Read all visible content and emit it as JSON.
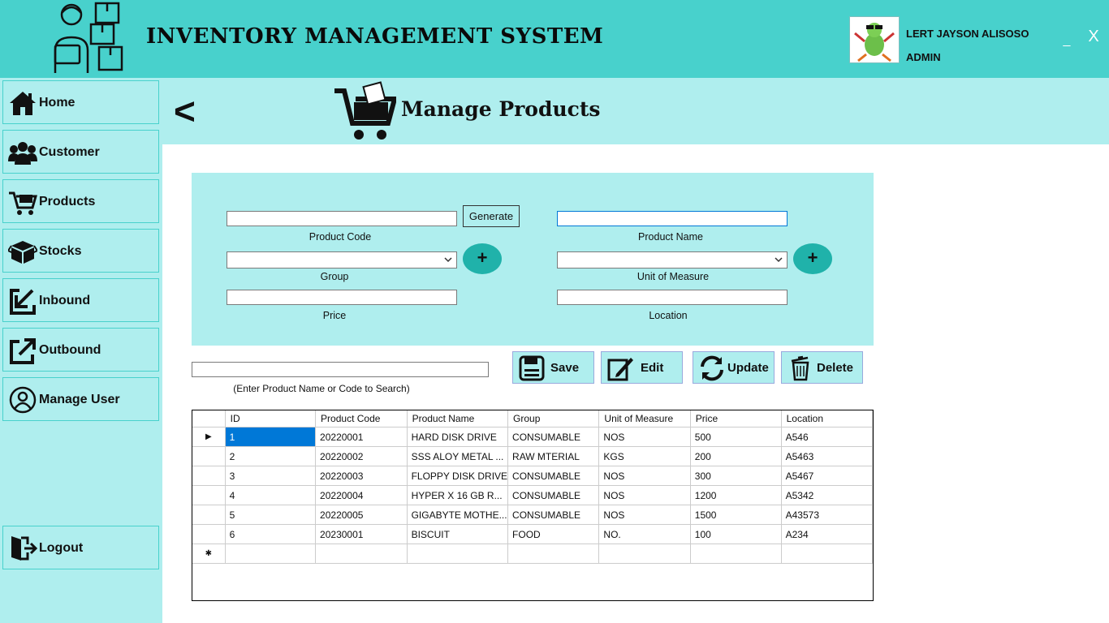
{
  "app": {
    "title": "INVENTORY MANAGEMENT SYSTEM",
    "user_name": "LERT JAYSON ALISOSO",
    "user_role": "ADMIN",
    "minimize": "_",
    "close": "X"
  },
  "sidebar": {
    "items": [
      {
        "label": "Home",
        "icon": "home-icon"
      },
      {
        "label": "Customer",
        "icon": "users-icon"
      },
      {
        "label": "Products",
        "icon": "cart-icon"
      },
      {
        "label": "Stocks",
        "icon": "boxes-icon"
      },
      {
        "label": "Inbound",
        "icon": "inbound-arrow-icon"
      },
      {
        "label": "Outbound",
        "icon": "outbound-arrow-icon"
      },
      {
        "label": "Manage User",
        "icon": "user-circle-icon"
      }
    ],
    "logout": "Logout"
  },
  "page": {
    "back": "<",
    "title": "Manage Products"
  },
  "form": {
    "product_code_label": "Product Code",
    "product_code_value": "",
    "generate": "Generate",
    "product_name_label": "Product Name",
    "product_name_value": "",
    "group_label": "Group",
    "uom_label": "Unit of Measure",
    "price_label": "Price",
    "location_label": "Location",
    "add_symbol": "+"
  },
  "search": {
    "value": "",
    "hint": "(Enter Product Name or Code to Search)"
  },
  "actions": {
    "save": "Save",
    "edit": "Edit",
    "update": "Update",
    "delete": "Delete"
  },
  "grid": {
    "columns": [
      "ID",
      "Product Code",
      "Product Name",
      "Group",
      "Unit of Measure",
      "Price",
      "Location"
    ],
    "rows": [
      [
        "1",
        "20220001",
        "HARD DISK DRIVE",
        "CONSUMABLE",
        "NOS",
        "500",
        "A546"
      ],
      [
        "2",
        "20220002",
        "SSS ALOY METAL ...",
        "RAW MTERIAL",
        "KGS",
        "200",
        "A5463"
      ],
      [
        "3",
        "20220003",
        "FLOPPY DISK DRIVE",
        "CONSUMABLE",
        "NOS",
        "300",
        "A5467"
      ],
      [
        "4",
        "20220004",
        "HYPER X 16 GB R...",
        "CONSUMABLE",
        "NOS",
        "1200",
        "A5342"
      ],
      [
        "5",
        "20220005",
        "GIGABYTE MOTHE...",
        "CONSUMABLE",
        "NOS",
        "1500",
        "A43573"
      ],
      [
        "6",
        "20230001",
        "BISCUIT",
        "FOOD",
        "NO.",
        "100",
        "A234"
      ]
    ],
    "current_row_marker": "▶",
    "new_row_marker": "✱",
    "selection_color": "#0078d7"
  },
  "colors": {
    "header": "#48d1cc",
    "panel": "#afeeee",
    "accent": "#20b2aa"
  }
}
